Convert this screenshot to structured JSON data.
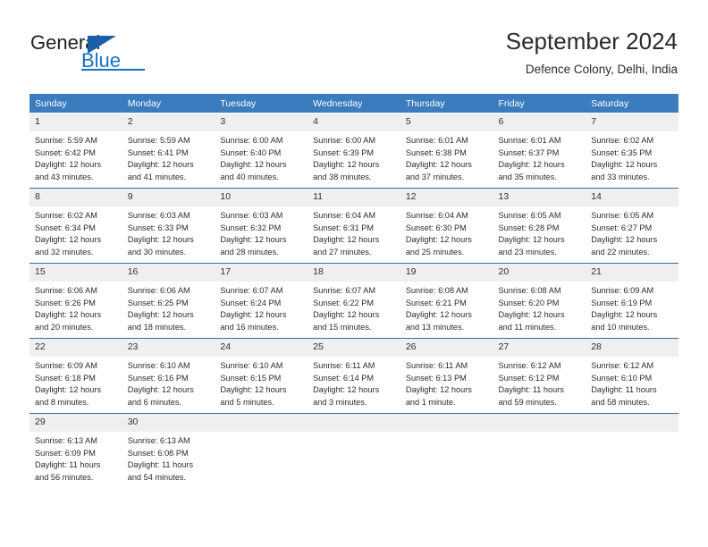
{
  "brand": {
    "name_part1": "General",
    "name_part2": "Blue",
    "logo_icon": "triangle-icon",
    "accent_color": "#1573c0"
  },
  "header": {
    "title": "September 2024",
    "subtitle": "Defence Colony, Delhi, India"
  },
  "theme": {
    "header_row_bg": "#3a7cbe",
    "daynum_bg": "#efefef",
    "week_separator": "#2f6da8",
    "text": "#2c2c2c"
  },
  "weekday_headers": [
    "Sunday",
    "Monday",
    "Tuesday",
    "Wednesday",
    "Thursday",
    "Friday",
    "Saturday"
  ],
  "labels": {
    "sunrise_prefix": "Sunrise:",
    "sunset_prefix": "Sunset:",
    "daylight_prefix": "Daylight:"
  },
  "weeks": [
    [
      {
        "day": "1",
        "sunrise": "Sunrise: 5:59 AM",
        "sunset": "Sunset: 6:42 PM",
        "daylight1": "Daylight: 12 hours",
        "daylight2": "and 43 minutes."
      },
      {
        "day": "2",
        "sunrise": "Sunrise: 5:59 AM",
        "sunset": "Sunset: 6:41 PM",
        "daylight1": "Daylight: 12 hours",
        "daylight2": "and 41 minutes."
      },
      {
        "day": "3",
        "sunrise": "Sunrise: 6:00 AM",
        "sunset": "Sunset: 6:40 PM",
        "daylight1": "Daylight: 12 hours",
        "daylight2": "and 40 minutes."
      },
      {
        "day": "4",
        "sunrise": "Sunrise: 6:00 AM",
        "sunset": "Sunset: 6:39 PM",
        "daylight1": "Daylight: 12 hours",
        "daylight2": "and 38 minutes."
      },
      {
        "day": "5",
        "sunrise": "Sunrise: 6:01 AM",
        "sunset": "Sunset: 6:38 PM",
        "daylight1": "Daylight: 12 hours",
        "daylight2": "and 37 minutes."
      },
      {
        "day": "6",
        "sunrise": "Sunrise: 6:01 AM",
        "sunset": "Sunset: 6:37 PM",
        "daylight1": "Daylight: 12 hours",
        "daylight2": "and 35 minutes."
      },
      {
        "day": "7",
        "sunrise": "Sunrise: 6:02 AM",
        "sunset": "Sunset: 6:35 PM",
        "daylight1": "Daylight: 12 hours",
        "daylight2": "and 33 minutes."
      }
    ],
    [
      {
        "day": "8",
        "sunrise": "Sunrise: 6:02 AM",
        "sunset": "Sunset: 6:34 PM",
        "daylight1": "Daylight: 12 hours",
        "daylight2": "and 32 minutes."
      },
      {
        "day": "9",
        "sunrise": "Sunrise: 6:03 AM",
        "sunset": "Sunset: 6:33 PM",
        "daylight1": "Daylight: 12 hours",
        "daylight2": "and 30 minutes."
      },
      {
        "day": "10",
        "sunrise": "Sunrise: 6:03 AM",
        "sunset": "Sunset: 6:32 PM",
        "daylight1": "Daylight: 12 hours",
        "daylight2": "and 28 minutes."
      },
      {
        "day": "11",
        "sunrise": "Sunrise: 6:04 AM",
        "sunset": "Sunset: 6:31 PM",
        "daylight1": "Daylight: 12 hours",
        "daylight2": "and 27 minutes."
      },
      {
        "day": "12",
        "sunrise": "Sunrise: 6:04 AM",
        "sunset": "Sunset: 6:30 PM",
        "daylight1": "Daylight: 12 hours",
        "daylight2": "and 25 minutes."
      },
      {
        "day": "13",
        "sunrise": "Sunrise: 6:05 AM",
        "sunset": "Sunset: 6:28 PM",
        "daylight1": "Daylight: 12 hours",
        "daylight2": "and 23 minutes."
      },
      {
        "day": "14",
        "sunrise": "Sunrise: 6:05 AM",
        "sunset": "Sunset: 6:27 PM",
        "daylight1": "Daylight: 12 hours",
        "daylight2": "and 22 minutes."
      }
    ],
    [
      {
        "day": "15",
        "sunrise": "Sunrise: 6:06 AM",
        "sunset": "Sunset: 6:26 PM",
        "daylight1": "Daylight: 12 hours",
        "daylight2": "and 20 minutes."
      },
      {
        "day": "16",
        "sunrise": "Sunrise: 6:06 AM",
        "sunset": "Sunset: 6:25 PM",
        "daylight1": "Daylight: 12 hours",
        "daylight2": "and 18 minutes."
      },
      {
        "day": "17",
        "sunrise": "Sunrise: 6:07 AM",
        "sunset": "Sunset: 6:24 PM",
        "daylight1": "Daylight: 12 hours",
        "daylight2": "and 16 minutes."
      },
      {
        "day": "18",
        "sunrise": "Sunrise: 6:07 AM",
        "sunset": "Sunset: 6:22 PM",
        "daylight1": "Daylight: 12 hours",
        "daylight2": "and 15 minutes."
      },
      {
        "day": "19",
        "sunrise": "Sunrise: 6:08 AM",
        "sunset": "Sunset: 6:21 PM",
        "daylight1": "Daylight: 12 hours",
        "daylight2": "and 13 minutes."
      },
      {
        "day": "20",
        "sunrise": "Sunrise: 6:08 AM",
        "sunset": "Sunset: 6:20 PM",
        "daylight1": "Daylight: 12 hours",
        "daylight2": "and 11 minutes."
      },
      {
        "day": "21",
        "sunrise": "Sunrise: 6:09 AM",
        "sunset": "Sunset: 6:19 PM",
        "daylight1": "Daylight: 12 hours",
        "daylight2": "and 10 minutes."
      }
    ],
    [
      {
        "day": "22",
        "sunrise": "Sunrise: 6:09 AM",
        "sunset": "Sunset: 6:18 PM",
        "daylight1": "Daylight: 12 hours",
        "daylight2": "and 8 minutes."
      },
      {
        "day": "23",
        "sunrise": "Sunrise: 6:10 AM",
        "sunset": "Sunset: 6:16 PM",
        "daylight1": "Daylight: 12 hours",
        "daylight2": "and 6 minutes."
      },
      {
        "day": "24",
        "sunrise": "Sunrise: 6:10 AM",
        "sunset": "Sunset: 6:15 PM",
        "daylight1": "Daylight: 12 hours",
        "daylight2": "and 5 minutes."
      },
      {
        "day": "25",
        "sunrise": "Sunrise: 6:11 AM",
        "sunset": "Sunset: 6:14 PM",
        "daylight1": "Daylight: 12 hours",
        "daylight2": "and 3 minutes."
      },
      {
        "day": "26",
        "sunrise": "Sunrise: 6:11 AM",
        "sunset": "Sunset: 6:13 PM",
        "daylight1": "Daylight: 12 hours",
        "daylight2": "and 1 minute."
      },
      {
        "day": "27",
        "sunrise": "Sunrise: 6:12 AM",
        "sunset": "Sunset: 6:12 PM",
        "daylight1": "Daylight: 11 hours",
        "daylight2": "and 59 minutes."
      },
      {
        "day": "28",
        "sunrise": "Sunrise: 6:12 AM",
        "sunset": "Sunset: 6:10 PM",
        "daylight1": "Daylight: 11 hours",
        "daylight2": "and 58 minutes."
      }
    ],
    [
      {
        "day": "29",
        "sunrise": "Sunrise: 6:13 AM",
        "sunset": "Sunset: 6:09 PM",
        "daylight1": "Daylight: 11 hours",
        "daylight2": "and 56 minutes."
      },
      {
        "day": "30",
        "sunrise": "Sunrise: 6:13 AM",
        "sunset": "Sunset: 6:08 PM",
        "daylight1": "Daylight: 11 hours",
        "daylight2": "and 54 minutes."
      },
      {
        "day": "",
        "sunrise": "",
        "sunset": "",
        "daylight1": "",
        "daylight2": ""
      },
      {
        "day": "",
        "sunrise": "",
        "sunset": "",
        "daylight1": "",
        "daylight2": ""
      },
      {
        "day": "",
        "sunrise": "",
        "sunset": "",
        "daylight1": "",
        "daylight2": ""
      },
      {
        "day": "",
        "sunrise": "",
        "sunset": "",
        "daylight1": "",
        "daylight2": ""
      },
      {
        "day": "",
        "sunrise": "",
        "sunset": "",
        "daylight1": "",
        "daylight2": ""
      }
    ]
  ]
}
